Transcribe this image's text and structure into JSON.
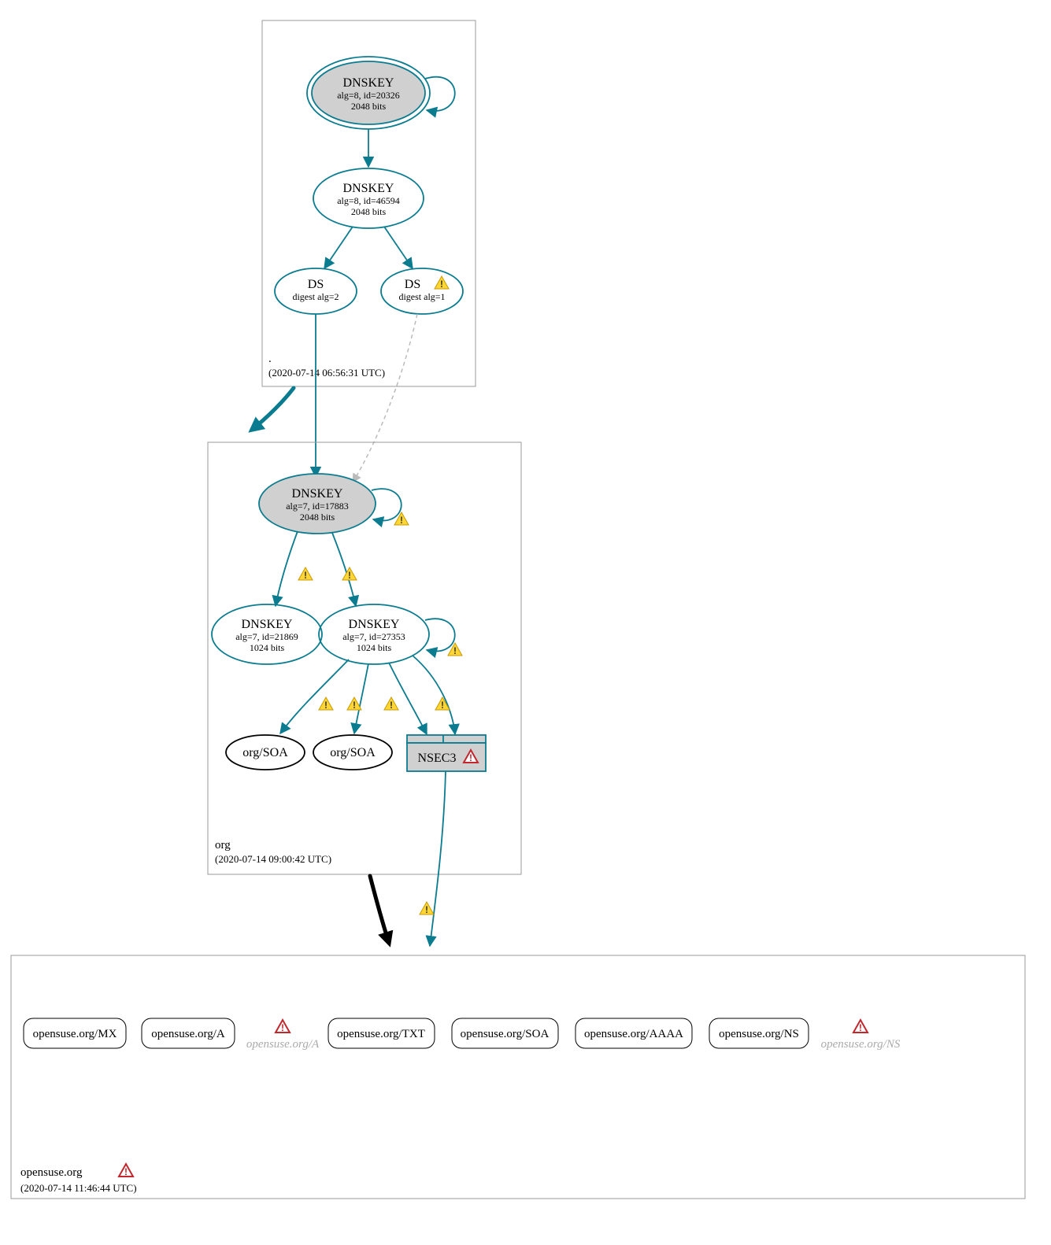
{
  "diagram_type": "DNSSEC authentication chain",
  "colors": {
    "teal": "#0b7c8f",
    "gray_fill": "#d0d0d0",
    "faded": "#aaa"
  },
  "zones": [
    {
      "id": "root",
      "label": ".",
      "timestamp": "(2020-07-14 06:56:31 UTC)",
      "nodes": [
        {
          "id": "root-ksk",
          "type": "DNSKEY",
          "title": "DNSKEY",
          "sub1": "alg=8, id=20326",
          "sub2": "2048 bits",
          "filled": true,
          "double_ring": true,
          "self_loop": true
        },
        {
          "id": "root-zsk",
          "type": "DNSKEY",
          "title": "DNSKEY",
          "sub1": "alg=8, id=46594",
          "sub2": "2048 bits"
        },
        {
          "id": "ds2",
          "type": "DS",
          "title": "DS",
          "sub1": "digest alg=2"
        },
        {
          "id": "ds1",
          "type": "DS",
          "title": "DS",
          "sub1": "digest alg=1",
          "warning": true
        }
      ],
      "edges": [
        {
          "from": "root-ksk",
          "to": "root-zsk"
        },
        {
          "from": "root-zsk",
          "to": "ds2"
        },
        {
          "from": "root-zsk",
          "to": "ds1"
        }
      ]
    },
    {
      "id": "org",
      "label": "org",
      "timestamp": "(2020-07-14 09:00:42 UTC)",
      "nodes": [
        {
          "id": "org-ksk",
          "type": "DNSKEY",
          "title": "DNSKEY",
          "sub1": "alg=7, id=17883",
          "sub2": "2048 bits",
          "filled": true,
          "self_loop": true,
          "self_loop_warning": true
        },
        {
          "id": "org-zsk1",
          "type": "DNSKEY",
          "title": "DNSKEY",
          "sub1": "alg=7, id=21869",
          "sub2": "1024 bits"
        },
        {
          "id": "org-zsk2",
          "type": "DNSKEY",
          "title": "DNSKEY",
          "sub1": "alg=7, id=27353",
          "sub2": "1024 bits",
          "self_loop": true,
          "self_loop_warning": true
        },
        {
          "id": "org-soa1",
          "type": "RR",
          "title": "org/SOA"
        },
        {
          "id": "org-soa2",
          "type": "RR",
          "title": "org/SOA"
        },
        {
          "id": "nsec3",
          "type": "NSEC3",
          "title": "NSEC3",
          "error": true
        }
      ],
      "edges": [
        {
          "from": "org-ksk",
          "to": "org-zsk1",
          "warning": true
        },
        {
          "from": "org-ksk",
          "to": "org-zsk2",
          "warning": true
        },
        {
          "from": "org-zsk2",
          "to": "org-soa1",
          "warning": true
        },
        {
          "from": "org-zsk2",
          "to": "org-soa2",
          "warning": true
        },
        {
          "from": "org-zsk2",
          "to": "nsec3",
          "warning": true
        },
        {
          "from": "org-zsk2",
          "to": "nsec3",
          "warning": true
        }
      ]
    },
    {
      "id": "opensuse",
      "label": "opensuse.org",
      "timestamp": "(2020-07-14 11:46:44 UTC)",
      "zone_error": true,
      "nodes": [
        {
          "id": "mx",
          "type": "RR",
          "title": "opensuse.org/MX"
        },
        {
          "id": "a",
          "type": "RR",
          "title": "opensuse.org/A"
        },
        {
          "id": "a-faded",
          "type": "RR-faded",
          "title": "opensuse.org/A",
          "error": true
        },
        {
          "id": "txt",
          "type": "RR",
          "title": "opensuse.org/TXT"
        },
        {
          "id": "soa",
          "type": "RR",
          "title": "opensuse.org/SOA"
        },
        {
          "id": "aaaa",
          "type": "RR",
          "title": "opensuse.org/AAAA"
        },
        {
          "id": "ns",
          "type": "RR",
          "title": "opensuse.org/NS"
        },
        {
          "id": "ns-faded",
          "type": "RR-faded",
          "title": "opensuse.org/NS",
          "error": true
        }
      ]
    }
  ],
  "delegations": [
    {
      "from_zone": "root",
      "to_zone": "org",
      "secure": true,
      "via_ds": "ds2"
    },
    {
      "from_zone": "root",
      "to_zone": "org",
      "secure": false,
      "via_ds": "ds1",
      "dashed": true
    },
    {
      "from_zone": "org",
      "to_zone": "opensuse",
      "secure": false,
      "via": "nsec3",
      "warning": true
    }
  ],
  "icons": {
    "warning": "yellow triangle exclamation",
    "error": "red triangle exclamation"
  }
}
